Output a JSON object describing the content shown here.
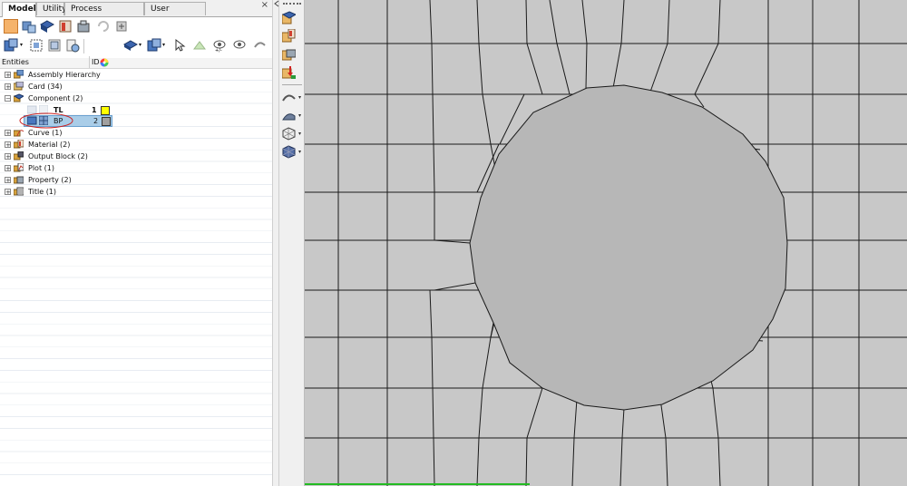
{
  "tabs": [
    {
      "label": "Model",
      "active": true
    },
    {
      "label": "Utility",
      "active": false
    },
    {
      "label": "Process Manager",
      "active": false
    },
    {
      "label": "User Process",
      "active": false
    }
  ],
  "close_glyph": "×",
  "entities_header": {
    "entities": "Entities",
    "id": "ID"
  },
  "tree": [
    {
      "label": "Assembly Hierarchy",
      "icon": "assembly-icon",
      "expand": "+"
    },
    {
      "label": "Card (34)",
      "icon": "card-icon",
      "expand": "+"
    },
    {
      "label": "Component (2)",
      "icon": "component-icon",
      "expand": "−"
    },
    {
      "label": "TL",
      "id": "1",
      "color": "#ffff00",
      "child": true
    },
    {
      "label": "BP",
      "id": "2",
      "color": "#a0a0a0",
      "child": true,
      "selected": true
    },
    {
      "label": "Curve (1)",
      "icon": "curve-icon",
      "expand": "+"
    },
    {
      "label": "Material (2)",
      "icon": "material-icon",
      "expand": "+"
    },
    {
      "label": "Output Block (2)",
      "icon": "output-block-icon",
      "expand": "+"
    },
    {
      "label": "Plot (1)",
      "icon": "plot-icon",
      "expand": "+"
    },
    {
      "label": "Property (2)",
      "icon": "property-icon",
      "expand": "+"
    },
    {
      "label": "Title (1)",
      "icon": "title-icon",
      "expand": "+"
    }
  ],
  "colors": {
    "mesh_fill": "#c8c8c8",
    "hole_fill": "#b7b7b7",
    "mesh_line": "#1a1a1a",
    "selection_bg": "#a9cde8",
    "annotation": "#cc2222",
    "status_line": "#22bb22"
  },
  "toolbar_icons": [
    "model-icon",
    "assembly-tool-icon",
    "component-tool-icon",
    "material-tool-icon",
    "property-tool-icon",
    "refresh-icon",
    "export-icon",
    "view-mode-icon",
    "select-icon",
    "isolate-icon",
    "hide-icon",
    "show-icon",
    "transparency-icon",
    "pointer-icon",
    "display-all-icon",
    "show-only-icon",
    "undo-view-icon"
  ],
  "vertical_icons": [
    "component-vicon",
    "material-vicon",
    "property-vicon",
    "load-vicon",
    "surface-vicon",
    "solid-vicon",
    "mesh-vicon",
    "element-vicon"
  ]
}
